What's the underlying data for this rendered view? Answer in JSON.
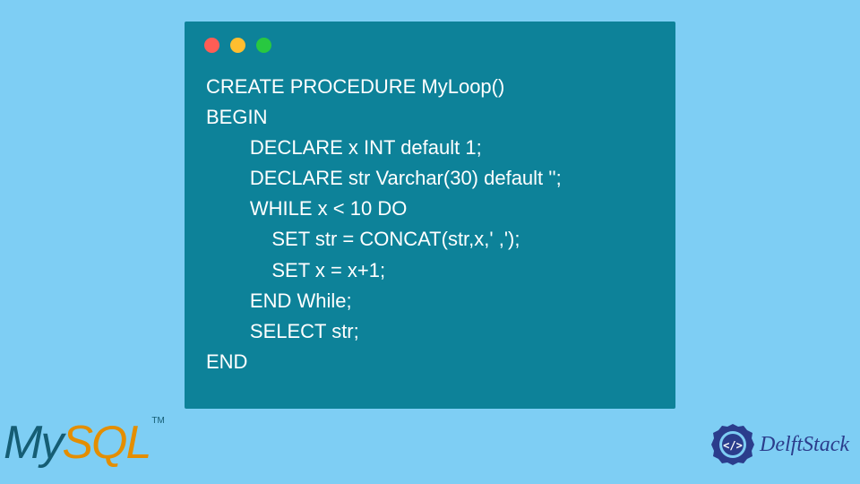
{
  "code": {
    "line1": "CREATE PROCEDURE MyLoop()",
    "line2": "BEGIN",
    "line3": "        DECLARE x INT default 1;",
    "line4": "        DECLARE str Varchar(30) default '';",
    "line5": "        WHILE x < 10 DO",
    "line6": "            SET str = CONCAT(str,x,' ,');",
    "line7": "            SET x = x+1;",
    "line8": "        END While;",
    "line9": "        SELECT str;",
    "line10": "END"
  },
  "logos": {
    "mysql_my": "My",
    "mysql_sql": "SQL",
    "mysql_tm": "TM",
    "delftstack": "DelftStack"
  },
  "colors": {
    "page_bg": "#7ecef4",
    "window_bg": "#0d8299",
    "btn_red": "#ff5d55",
    "btn_yellow": "#ffbe2f",
    "btn_green": "#28c840",
    "mysql_dark": "#155d74",
    "mysql_orange": "#e48e00",
    "delft_blue": "#2b3d8c"
  }
}
